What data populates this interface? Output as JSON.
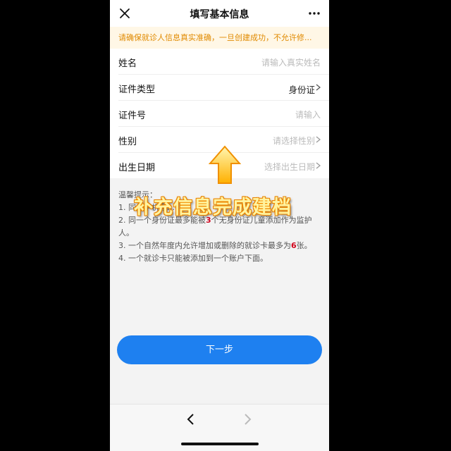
{
  "header": {
    "title": "填写基本信息"
  },
  "notice": "请确保就诊人信息真实准确，一旦创建成功，不允许修...",
  "form": {
    "rows": [
      {
        "label": "姓名",
        "value": "请输入真实姓名"
      },
      {
        "label": "证件类型",
        "value": "身份证"
      },
      {
        "label": "证件号",
        "value": "请输入"
      },
      {
        "label": "性别",
        "value": "请选择性别"
      },
      {
        "label": "出生日期",
        "value": "选择出生日期"
      }
    ]
  },
  "tips": {
    "heading": "温馨提示：",
    "line1": "1. 同一手机号…",
    "line2a": "2. 同一个身份证最多能被",
    "line2num": "3",
    "line2b": "个无身份证儿童添加作为监护人。",
    "line3a": "3. 一个自然年度内允许增加或删除的就诊卡最多为",
    "line3num": "6",
    "line3b": "张。",
    "line4": "4. 一个就诊卡只能被添加到一个账户下面。"
  },
  "next_button": "下一步",
  "overlay": {
    "caption": "补充信息完成建档"
  },
  "icons": {
    "close": "close-icon",
    "more": "more-icon",
    "chevron": "chevron-right-icon",
    "back": "back-arrow-icon",
    "forward": "forward-arrow-icon",
    "arrow": "up-arrow-icon"
  },
  "colors": {
    "accent": "#1e80f0",
    "notice_text": "#e08a00",
    "notice_bg": "#fff7e6",
    "highlight": "#d0021b"
  }
}
